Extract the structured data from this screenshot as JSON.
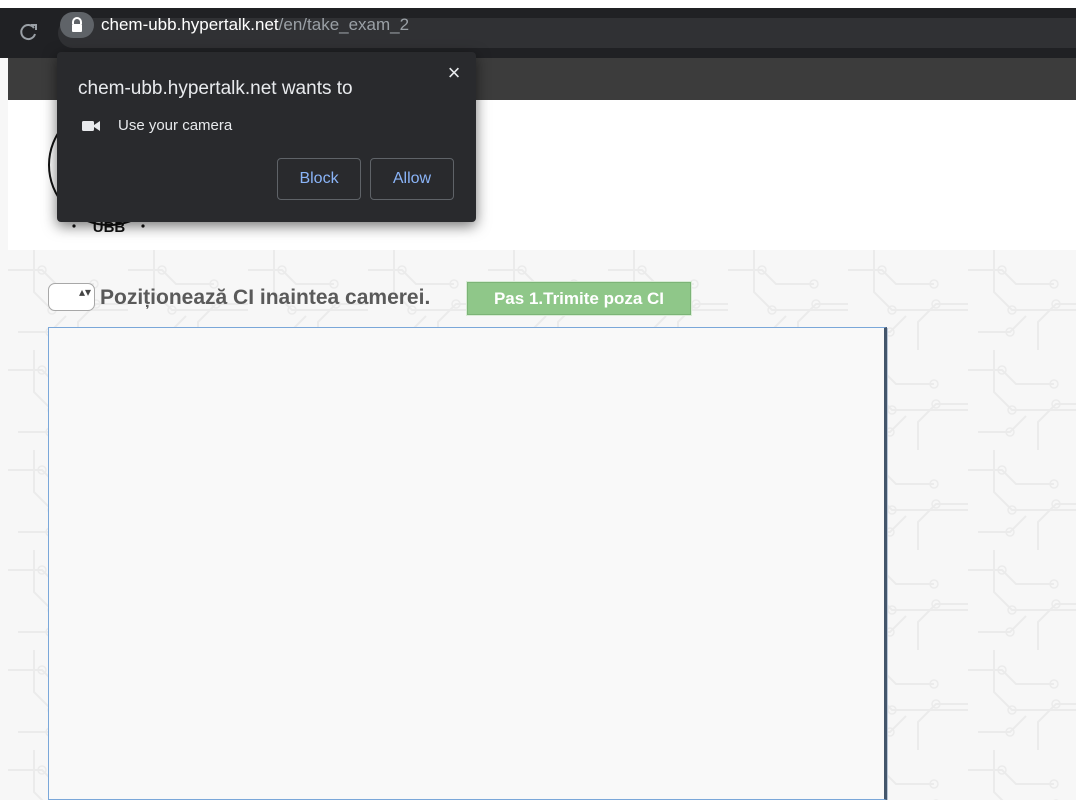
{
  "browser": {
    "url_host": "chem-ubb.hypertalk.net",
    "url_path": "/en/take_exam_2",
    "icons": {
      "reload": "reload-icon",
      "lock": "lock-icon"
    }
  },
  "permission_popup": {
    "title": "chem-ubb.hypertalk.net wants to",
    "permission": "Use your camera",
    "block_label": "Block",
    "allow_label": "Allow",
    "close_glyph": "×",
    "icons": {
      "camera": "camera-icon",
      "close": "close-icon"
    }
  },
  "page": {
    "instruction": "Poziționează CI inaintea camerei.",
    "button_label": "Pas 1.Trimite poza CI",
    "stepper_glyph": "▴▾",
    "logo_text": "UBB"
  },
  "colors": {
    "chrome_bar": "#202124",
    "popup_background": "#292a2d",
    "popup_button_text": "#8ab4f8",
    "green_button": "#8fc789",
    "camera_frame_border": "#7aa7d9"
  }
}
